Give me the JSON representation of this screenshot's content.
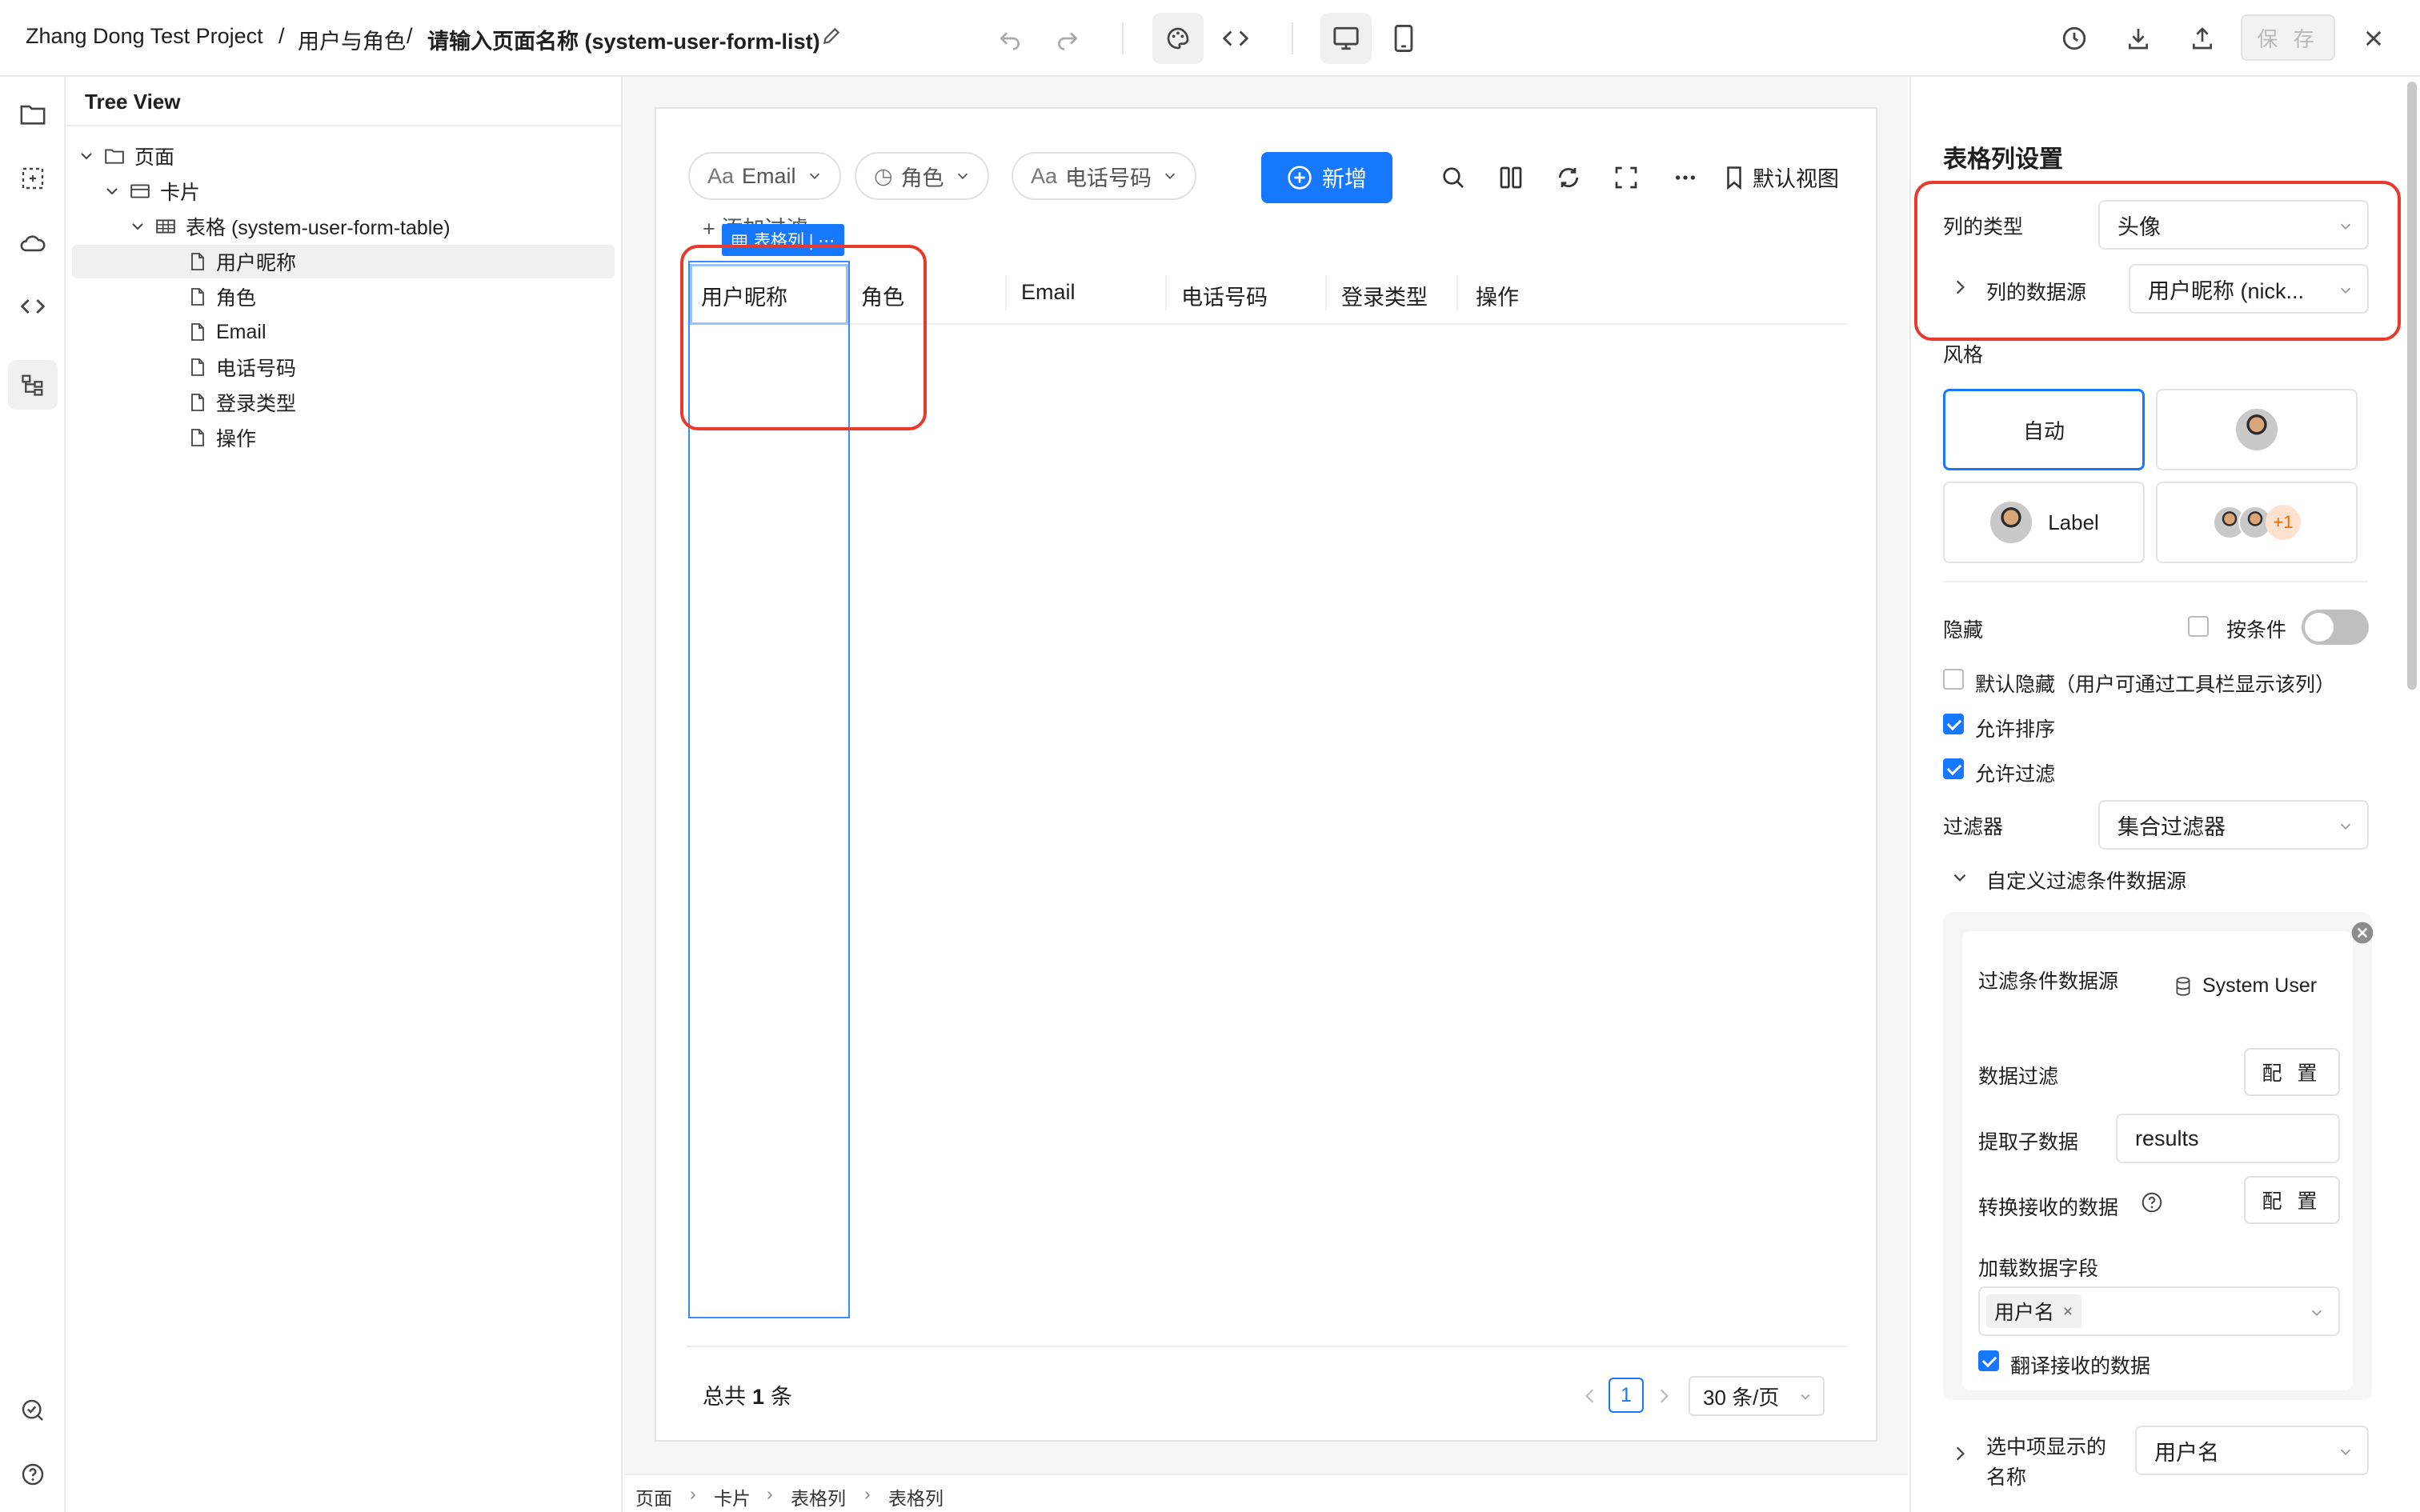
{
  "header": {
    "project": "Zhang Dong Test Project",
    "sep": "/",
    "section": "用户与角色",
    "page_name": "请输入页面名称 (system-user-form-list)",
    "save_label": "保 存"
  },
  "tree": {
    "title": "Tree View",
    "nodes": [
      {
        "label": "页面",
        "icon": "folder-icon"
      },
      {
        "label": "卡片",
        "icon": "card-icon"
      },
      {
        "label": "表格 (system-user-form-table)",
        "icon": "table-icon"
      },
      {
        "label": "用户昵称",
        "icon": "file-icon"
      },
      {
        "label": "角色",
        "icon": "file-icon"
      },
      {
        "label": "Email",
        "icon": "file-icon"
      },
      {
        "label": "电话号码",
        "icon": "file-icon"
      },
      {
        "label": "登录类型",
        "icon": "file-icon"
      },
      {
        "label": "操作",
        "icon": "file-icon"
      }
    ]
  },
  "toolbar": {
    "filters": [
      {
        "prefix": "Aa",
        "label": "Email"
      },
      {
        "prefix": "◷",
        "label": "角色"
      },
      {
        "prefix": "Aa",
        "label": "电话号码"
      }
    ],
    "add_label": "新增",
    "default_view": "默认视图",
    "add_filter": "+ 添加过滤"
  },
  "table": {
    "columns": [
      "用户昵称",
      "角色",
      "Email",
      "电话号码",
      "登录类型",
      "操作"
    ],
    "selected_badge": "表格列 | ⋯",
    "total_prefix": "总共",
    "total_count": "1",
    "total_suffix": "条",
    "page": "1",
    "page_size": "30 条/页"
  },
  "statusbar": {
    "crumbs": [
      "页面",
      "卡片",
      "表格列",
      "表格列"
    ]
  },
  "panel": {
    "title": "表格列设置",
    "column_type_label": "列的类型",
    "column_type_value": "头像",
    "datasource_label": "列的数据源",
    "datasource_value": "用户昵称 (nick...",
    "style_label": "风格",
    "style_auto": "自动",
    "style_label_option": "Label",
    "plus_one": "+1",
    "hidden_label": "隐藏",
    "by_condition": "按条件",
    "default_hidden": "默认隐藏（用户可通过工具栏显示该列）",
    "allow_sort": "允许排序",
    "allow_filter": "允许过滤",
    "filter_label": "过滤器",
    "filter_value": "集合过滤器",
    "custom_filter_ds": "自定义过滤条件数据源",
    "filter_ds_label": "过滤条件数据源",
    "filter_ds_value": "System User",
    "data_filter": "数据过滤",
    "config": "配 置",
    "extract_child": "提取子数据",
    "extract_value": "results",
    "transform": "转换接收的数据",
    "load_fields": "加载数据字段",
    "field_tag": "用户名",
    "translate": "翻译接收的数据",
    "selected_display": "选中项显示的名称",
    "selected_display_value": "用户名"
  }
}
